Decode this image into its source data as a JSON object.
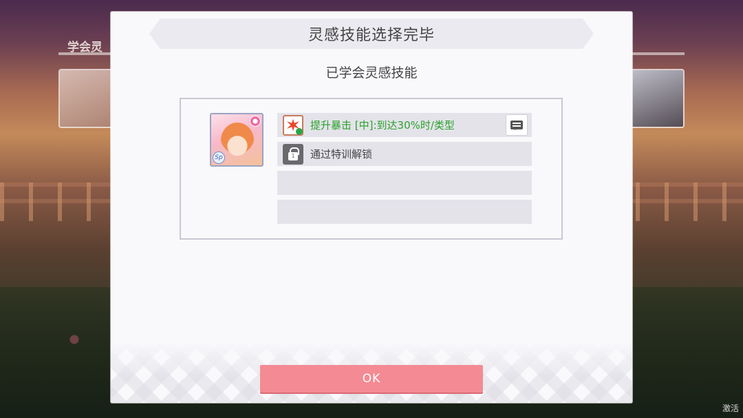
{
  "background": {
    "header_label": "学会灵",
    "corner_text": "激活"
  },
  "dialog": {
    "title": "灵感技能选择完毕",
    "subtitle": "已学会灵感技能",
    "skills": [
      {
        "text": "提升暴击 [中]:到达30%时/类型",
        "icon": "critical-burst-icon",
        "color": "#2aa12a"
      },
      {
        "text": "通过特训解锁",
        "icon": "lock-icon",
        "lock_number": "1"
      },
      {
        "text": ""
      },
      {
        "text": ""
      }
    ],
    "card": {
      "badge": "Sp"
    },
    "ok_label": "OK"
  },
  "colors": {
    "ok_button": "#f48a93",
    "skill_highlight": "#2aa12a"
  }
}
